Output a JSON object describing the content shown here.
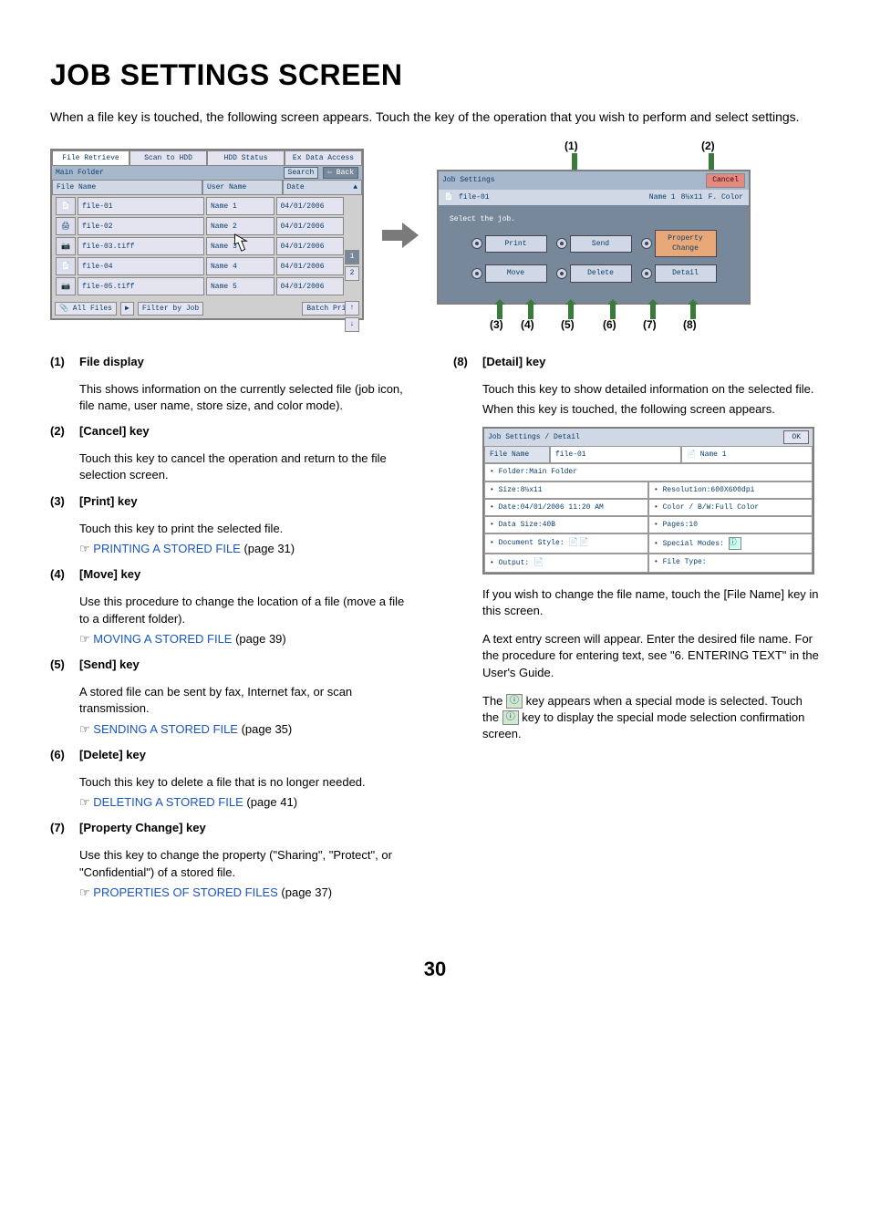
{
  "title": "JOB SETTINGS SCREEN",
  "intro": "When a file key is touched, the following screen appears. Touch the key of the operation that you wish to perform and select settings.",
  "panel1": {
    "tabs": [
      "File Retrieve",
      "Scan to HDD",
      "HDD Status",
      "Ex Data Access"
    ],
    "folder_label": "Main Folder",
    "search_btn": "Search",
    "back_btn": "Back",
    "headers": {
      "file": "File Name",
      "user": "User Name",
      "date": "Date"
    },
    "rows": [
      {
        "file": "file-01",
        "user": "Name 1",
        "date": "04/01/2006"
      },
      {
        "file": "file-02",
        "user": "Name 2",
        "date": "04/01/2006"
      },
      {
        "file": "file-03.tiff",
        "user": "Name 3",
        "date": "04/01/2006"
      },
      {
        "file": "file-04",
        "user": "Name 4",
        "date": "04/01/2006"
      },
      {
        "file": "file-05.tiff",
        "user": "Name 5",
        "date": "04/01/2006"
      }
    ],
    "page_current": "1",
    "page_total": "2",
    "all_files": "All Files",
    "filter": "Filter by Job",
    "batch": "Batch Print"
  },
  "panel2": {
    "title": "Job Settings",
    "cancel": "Cancel",
    "file_icon_file": "file-01",
    "file_icon_user": "Name 1",
    "file_icon_size": "8½x11",
    "file_icon_color": "F. Color",
    "select_text": "Select the job.",
    "ops": {
      "print": "Print",
      "send": "Send",
      "property": "Property Change",
      "move": "Move",
      "delete": "Delete",
      "detail": "Detail"
    }
  },
  "callout_labels": {
    "c1": "(1)",
    "c2": "(2)",
    "c3": "(3)",
    "c4": "(4)",
    "c5": "(5)",
    "c6": "(6)",
    "c7": "(7)",
    "c8": "(8)"
  },
  "left_items": [
    {
      "num": "(1)",
      "title": "File display",
      "desc": "This shows information on the currently selected file (job icon, file name, user name, store size, and color mode)."
    },
    {
      "num": "(2)",
      "title": "[Cancel] key",
      "desc": "Touch this key to cancel the operation and return to the file selection screen."
    },
    {
      "num": "(3)",
      "title": "[Print] key",
      "desc": "Touch this key to print the selected file.",
      "link": "PRINTING A STORED FILE",
      "page": " (page 31)"
    },
    {
      "num": "(4)",
      "title": "[Move] key",
      "desc": "Use this procedure to change the location of a file (move a file to a different folder).",
      "link": "MOVING A STORED FILE",
      "page": " (page 39)"
    },
    {
      "num": "(5)",
      "title": "[Send] key",
      "desc": "A stored file can be sent by fax, Internet fax, or scan transmission.",
      "link": "SENDING A STORED FILE",
      "page": " (page 35)"
    },
    {
      "num": "(6)",
      "title": "[Delete] key",
      "desc": "Touch this key to delete a file that is no longer needed.",
      "link": "DELETING A STORED FILE",
      "page": " (page 41)"
    },
    {
      "num": "(7)",
      "title": "[Property Change] key",
      "desc": "Use this key to change the property (\"Sharing\", \"Protect\", or \"Confidential\") of a stored file.",
      "link": "PROPERTIES OF STORED FILES",
      "page": " (page 37)"
    }
  ],
  "right_item": {
    "num": "(8)",
    "title": "[Detail] key",
    "desc1": "Touch this key to show detailed information on the selected file.",
    "desc2": "When this key is touched, the following screen appears."
  },
  "detail_panel": {
    "breadcrumb": "Job Settings / Detail",
    "ok": "OK",
    "file_name_label": "File Name",
    "file_name_value": "file-01",
    "user_value": "Name 1",
    "rows": [
      [
        "Folder:Main Folder",
        ""
      ],
      [
        "Size:8½x11",
        "Resolution:600X600dpi"
      ],
      [
        "Date:04/01/2006 11:20 AM",
        "Color / B/W:Full Color"
      ],
      [
        "Data Size:40B",
        "Pages:10"
      ],
      [
        "Document Style:",
        "Special Modes:"
      ],
      [
        "Output:",
        "File Type:"
      ]
    ]
  },
  "after_detail": {
    "p1": "If you wish to change the file name, touch the [File Name] key in this screen.",
    "p2": "A text entry screen will appear. Enter the desired file name. For the procedure for entering text, see \"6. ENTERING TEXT\" in the User's Guide.",
    "p3a": "The ",
    "p3b": " key appears when a special mode is selected. Touch the ",
    "p3c": " key to display the special mode selection confirmation screen."
  },
  "page_number": "30"
}
